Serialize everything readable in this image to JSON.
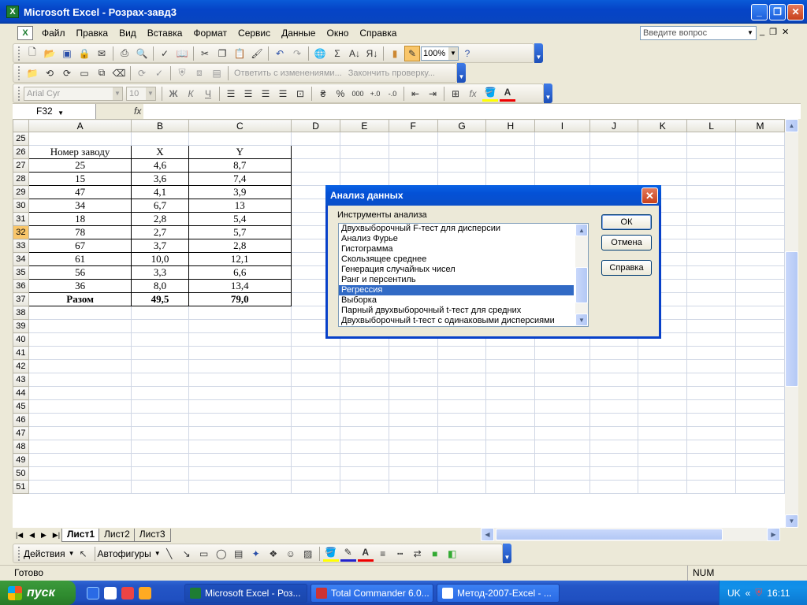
{
  "window": {
    "title": "Microsoft Excel - Розрах-завд3",
    "app_icon": "X"
  },
  "menu": [
    "Файл",
    "Правка",
    "Вид",
    "Вставка",
    "Формат",
    "Сервис",
    "Данные",
    "Окно",
    "Справка"
  ],
  "help": {
    "placeholder": "Введите вопрос"
  },
  "toolbar": {
    "zoom": "100%",
    "review_reply": "Ответить с изменениями...",
    "review_end": "Закончить проверку...",
    "font": "Arial Cyr",
    "size": "10"
  },
  "formula": {
    "cell": "F32",
    "fx": "fx"
  },
  "grid": {
    "columns": [
      "A",
      "B",
      "C",
      "D",
      "E",
      "F",
      "G",
      "H",
      "I",
      "J",
      "K",
      "L",
      "M"
    ],
    "active_column": "F",
    "active_row": "32",
    "rows": [
      {
        "n": "25",
        "a": "",
        "b": "",
        "c": ""
      },
      {
        "n": "26",
        "a": "Номер заводу",
        "b": "X",
        "c": "Y"
      },
      {
        "n": "27",
        "a": "25",
        "b": "4,6",
        "c": "8,7"
      },
      {
        "n": "28",
        "a": "15",
        "b": "3,6",
        "c": "7,4"
      },
      {
        "n": "29",
        "a": "47",
        "b": "4,1",
        "c": "3,9"
      },
      {
        "n": "30",
        "a": "34",
        "b": "6,7",
        "c": "13"
      },
      {
        "n": "31",
        "a": "18",
        "b": "2,8",
        "c": "5,4"
      },
      {
        "n": "32",
        "a": "78",
        "b": "2,7",
        "c": "5,7"
      },
      {
        "n": "33",
        "a": "67",
        "b": "3,7",
        "c": "2,8"
      },
      {
        "n": "34",
        "a": "61",
        "b": "10,0",
        "c": "12,1"
      },
      {
        "n": "35",
        "a": "56",
        "b": "3,3",
        "c": "6,6"
      },
      {
        "n": "36",
        "a": "36",
        "b": "8,0",
        "c": "13,4"
      },
      {
        "n": "37",
        "a": "Разом",
        "b": "49,5",
        "c": "79,0"
      },
      {
        "n": "38",
        "a": "",
        "b": "",
        "c": ""
      },
      {
        "n": "39",
        "a": "",
        "b": "",
        "c": ""
      },
      {
        "n": "40",
        "a": "",
        "b": "",
        "c": ""
      },
      {
        "n": "41",
        "a": "",
        "b": "",
        "c": ""
      },
      {
        "n": "42",
        "a": "",
        "b": "",
        "c": ""
      },
      {
        "n": "43",
        "a": "",
        "b": "",
        "c": ""
      },
      {
        "n": "44",
        "a": "",
        "b": "",
        "c": ""
      },
      {
        "n": "45",
        "a": "",
        "b": "",
        "c": ""
      },
      {
        "n": "46",
        "a": "",
        "b": "",
        "c": ""
      },
      {
        "n": "47",
        "a": "",
        "b": "",
        "c": ""
      },
      {
        "n": "48",
        "a": "",
        "b": "",
        "c": ""
      },
      {
        "n": "49",
        "a": "",
        "b": "",
        "c": ""
      },
      {
        "n": "50",
        "a": "",
        "b": "",
        "c": ""
      },
      {
        "n": "51",
        "a": "",
        "b": "",
        "c": ""
      }
    ]
  },
  "sheets": [
    "Лист1",
    "Лист2",
    "Лист3"
  ],
  "drawbar": {
    "actions": "Действия",
    "autoshapes": "Автофигуры"
  },
  "status": {
    "text": "Готово",
    "num": "NUM"
  },
  "taskbar": {
    "start": "пуск",
    "tasks": [
      "Microsoft Excel - Роз...",
      "Total Commander 6.0...",
      "Метод-2007-Excel - ..."
    ],
    "lang": "UK",
    "time": "16:11"
  },
  "dialog": {
    "title": "Анализ данных",
    "label": "Инструменты анализа",
    "items": [
      "Двухвыборочный F-тест для дисперсии",
      "Анализ Фурье",
      "Гистограмма",
      "Скользящее среднее",
      "Генерация случайных чисел",
      "Ранг и персентиль",
      "Регрессия",
      "Выборка",
      "Парный двухвыборочный t-тест для средних",
      "Двухвыборочный t-тест с одинаковыми дисперсиями"
    ],
    "selected": "Регрессия",
    "ok": "ОК",
    "cancel": "Отмена",
    "help": "Справка"
  }
}
